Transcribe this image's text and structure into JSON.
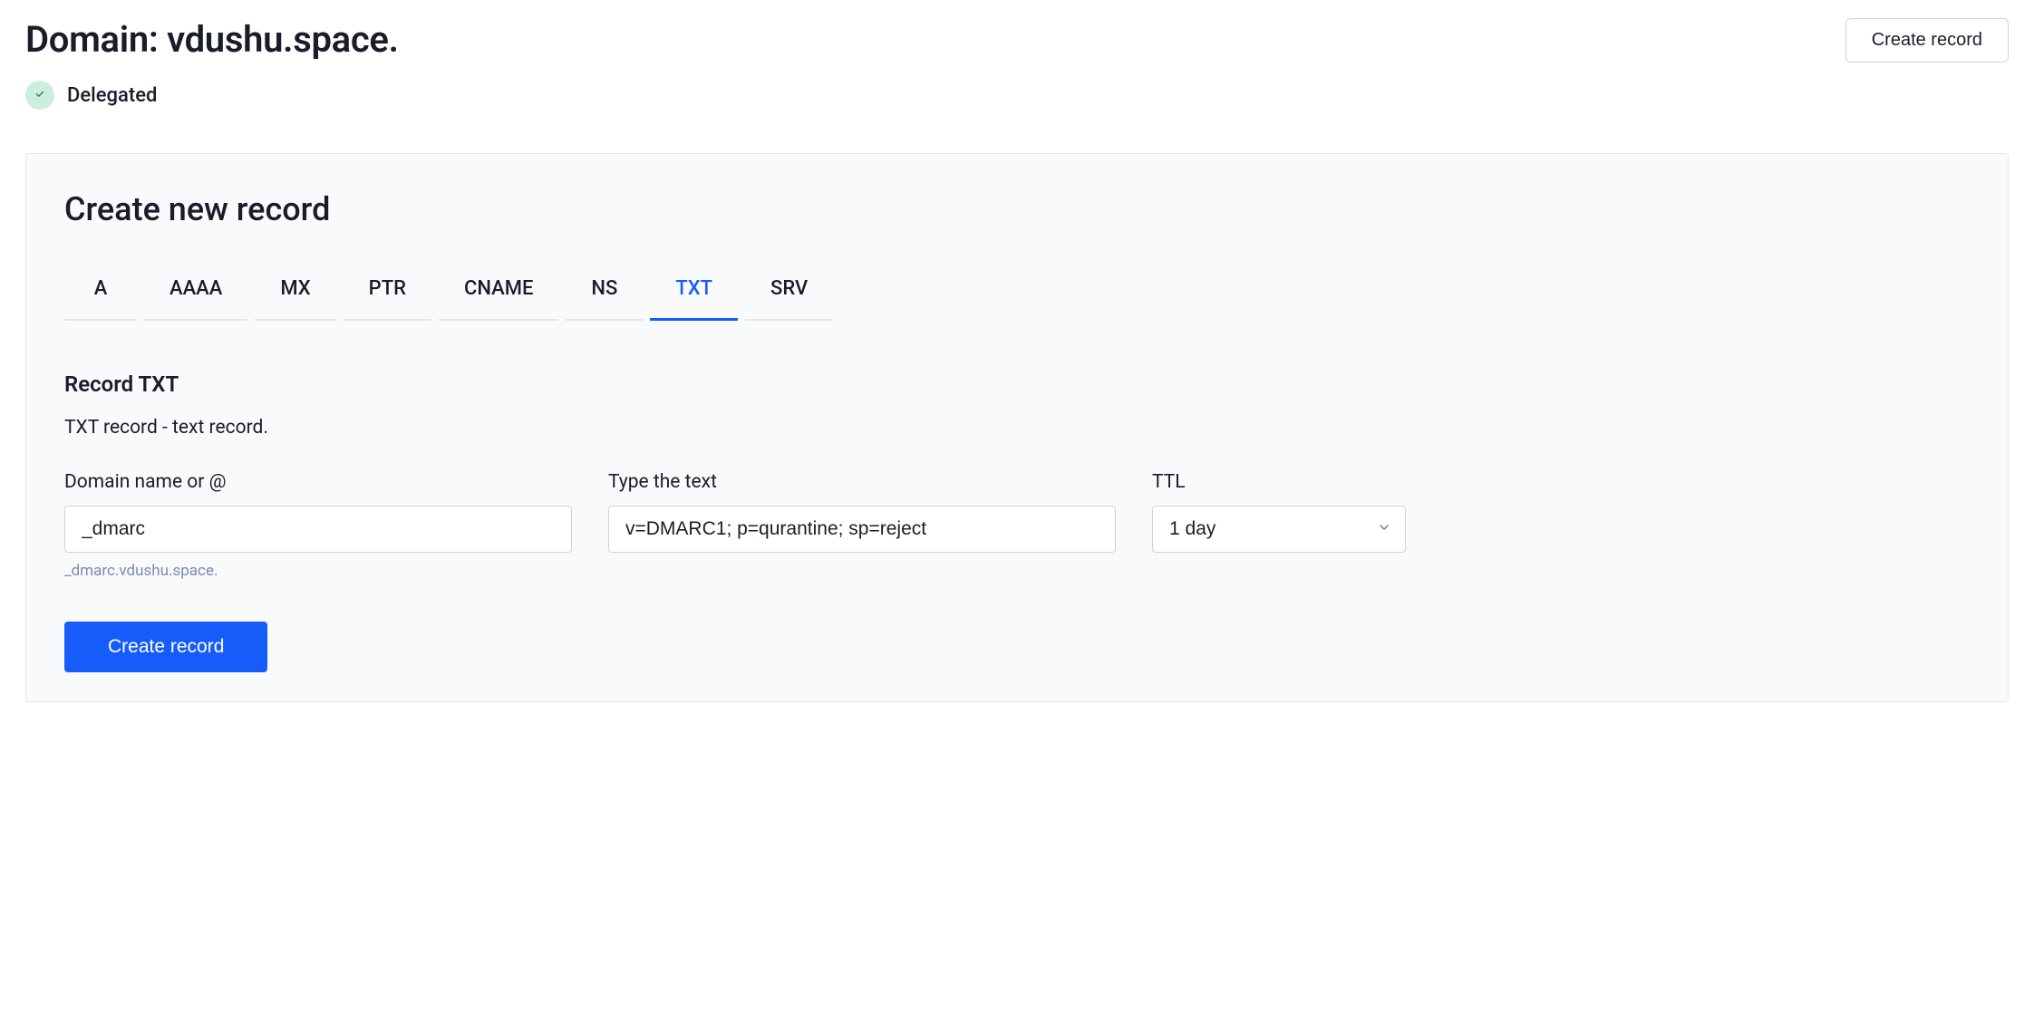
{
  "header": {
    "title": "Domain: vdushu.space.",
    "create_button": "Create record",
    "status_text": "Delegated"
  },
  "panel": {
    "title": "Create new record",
    "tabs": [
      {
        "label": "A",
        "active": false
      },
      {
        "label": "AAAA",
        "active": false
      },
      {
        "label": "MX",
        "active": false
      },
      {
        "label": "PTR",
        "active": false
      },
      {
        "label": "CNAME",
        "active": false
      },
      {
        "label": "NS",
        "active": false
      },
      {
        "label": "TXT",
        "active": true
      },
      {
        "label": "SRV",
        "active": false
      }
    ],
    "section": {
      "heading": "Record TXT",
      "description": "TXT record - text record."
    },
    "form": {
      "domain": {
        "label": "Domain name or @",
        "value": "_dmarc",
        "helper": "_dmarc.vdushu.space."
      },
      "text": {
        "label": "Type the text",
        "value": "v=DMARC1; p=qurantine; sp=reject"
      },
      "ttl": {
        "label": "TTL",
        "value": "1 day"
      },
      "submit_label": "Create record"
    }
  }
}
